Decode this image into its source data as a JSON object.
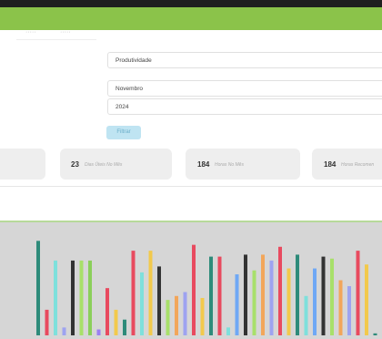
{
  "window": {
    "tabs": [
      {
        "label": "·····"
      },
      {
        "label": "·····"
      }
    ]
  },
  "filters": {
    "report": "Produtividade",
    "month": "Novembro",
    "year": "2024",
    "button_label": "Filtrar"
  },
  "stats": [
    {
      "number": "",
      "label": ""
    },
    {
      "number": "23",
      "label": "Dias Úteis No Mês"
    },
    {
      "number": "184",
      "label": "Horas No Mês"
    },
    {
      "number": "184",
      "label": "Horas Recomen"
    }
  ],
  "chart_data": {
    "type": "bar",
    "values": [
      96,
      26,
      76,
      8,
      76,
      76,
      76,
      6,
      48,
      26,
      16,
      86,
      64,
      86,
      70,
      36,
      40,
      44,
      92,
      38,
      80,
      80,
      8,
      62,
      82,
      66,
      82,
      76,
      90,
      68,
      82,
      40,
      68,
      80,
      78,
      56,
      50,
      86,
      72,
      2
    ],
    "colors": [
      "#2e8b7a",
      "#e84a5f",
      "#7ee0dc",
      "#9ea3f0",
      "#333333",
      "#a8e06a",
      "#8bcf5a",
      "#9b7ff2",
      "#e84a5f",
      "#f2c94c",
      "#2e8b7a",
      "#e84a5f",
      "#7ee0dc",
      "#f2c94c",
      "#333333",
      "#a8e06a",
      "#f2a65a",
      "#9ea3f0",
      "#e84a5f",
      "#f2c94c",
      "#2e8b7a",
      "#e84a5f",
      "#7ee0dc",
      "#6fa8f5",
      "#333333",
      "#a8e06a",
      "#f2a65a",
      "#9ea3f0",
      "#e84a5f",
      "#f2c94c",
      "#2e8b7a",
      "#7ee0dc",
      "#6fa8f5",
      "#333333",
      "#a8e06a",
      "#f2a65a",
      "#9ea3f0",
      "#e84a5f",
      "#f2c94c",
      "#2e8b7a"
    ],
    "ylim": [
      0,
      100
    ]
  }
}
